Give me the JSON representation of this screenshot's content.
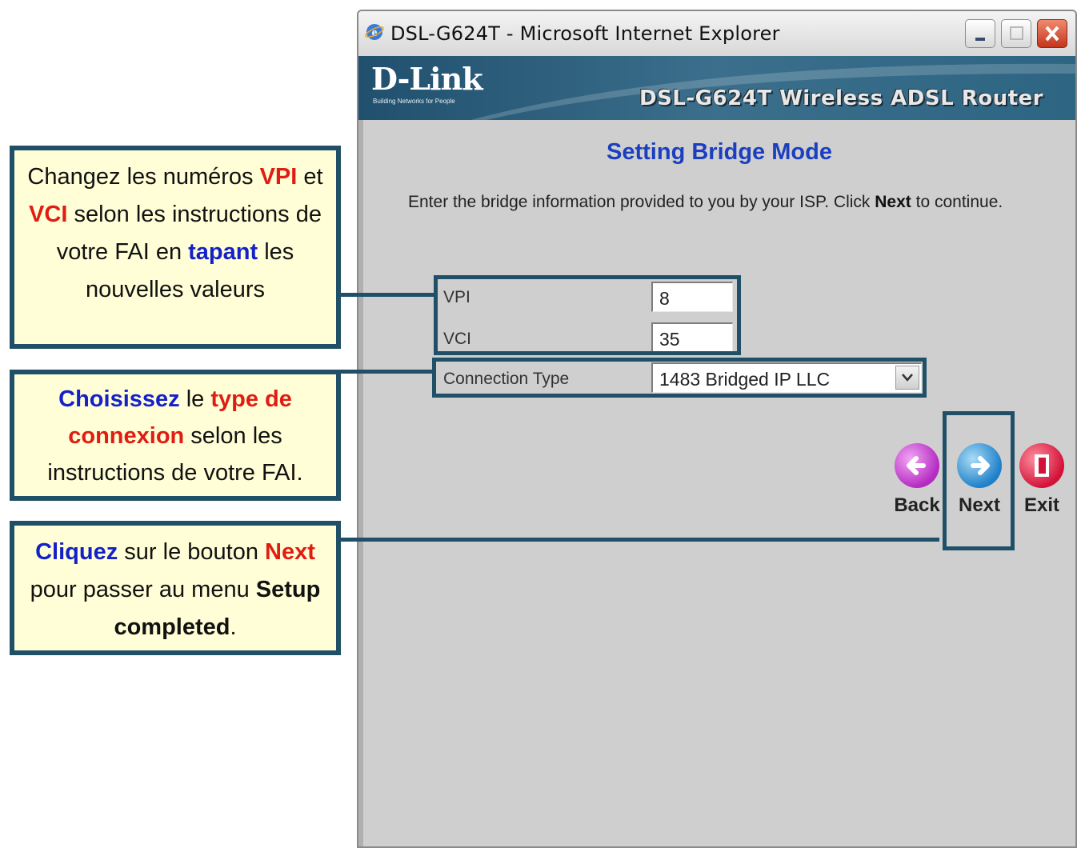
{
  "window": {
    "title": "DSL-G624T - Microsoft Internet Explorer"
  },
  "banner": {
    "logo": "D-Link",
    "logo_tagline": "Building Networks for People",
    "product": "DSL-G624T Wireless ADSL Router"
  },
  "page": {
    "title": "Setting Bridge Mode",
    "instructions_before": "Enter the bridge information provided to you by your ISP. Click ",
    "instructions_bold": "Next",
    "instructions_after": " to continue."
  },
  "form": {
    "vpi": {
      "label": "VPI",
      "value": "8"
    },
    "vci": {
      "label": "VCI",
      "value": "35"
    },
    "connection_type": {
      "label": "Connection Type",
      "value": "1483 Bridged IP LLC"
    }
  },
  "nav": {
    "back_label": "Back",
    "next_label": "Next",
    "exit_label": "Exit"
  },
  "callouts": {
    "vpi_vci": {
      "t1": "Changez les numéros ",
      "t2": "VPI",
      "t3": " et ",
      "t4": "VCI",
      "t5": " selon les instructions de votre FAI en ",
      "t6": "tapant",
      "t7": " les nouvelles valeurs"
    },
    "connection": {
      "t1": "Choisissez",
      "t2": " le ",
      "t3": "type de connexion",
      "t4": " selon les instructions de votre FAI."
    },
    "next": {
      "t1": "Cliquez",
      "t2": " sur le bouton ",
      "t3": "Next",
      "t4": " pour passer au menu ",
      "t5": "Setup completed",
      "t6": "."
    }
  },
  "colors": {
    "callout_bg": "#fffed6",
    "callout_border": "#1f5068",
    "highlight_red": "#e01d12",
    "highlight_blue": "#1421c8",
    "page_title": "#1b3fbf"
  }
}
